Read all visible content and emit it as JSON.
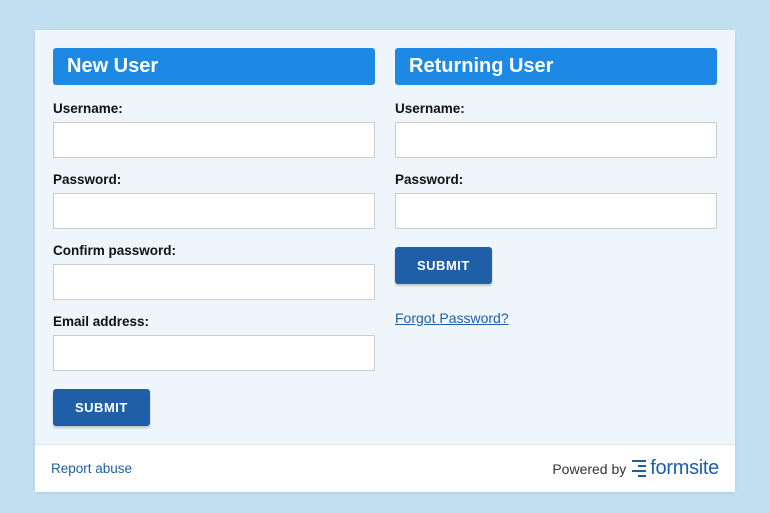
{
  "newUser": {
    "header": "New User",
    "usernameLabel": "Username:",
    "usernameValue": "",
    "passwordLabel": "Password:",
    "passwordValue": "",
    "confirmLabel": "Confirm password:",
    "confirmValue": "",
    "emailLabel": "Email address:",
    "emailValue": "",
    "submitLabel": "SUBMIT"
  },
  "returningUser": {
    "header": "Returning User",
    "usernameLabel": "Username:",
    "usernameValue": "",
    "passwordLabel": "Password:",
    "passwordValue": "",
    "submitLabel": "SUBMIT",
    "forgotLabel": "Forgot Password?"
  },
  "footer": {
    "reportLabel": "Report abuse",
    "poweredByLabel": "Powered by",
    "brandName": "formsite"
  }
}
